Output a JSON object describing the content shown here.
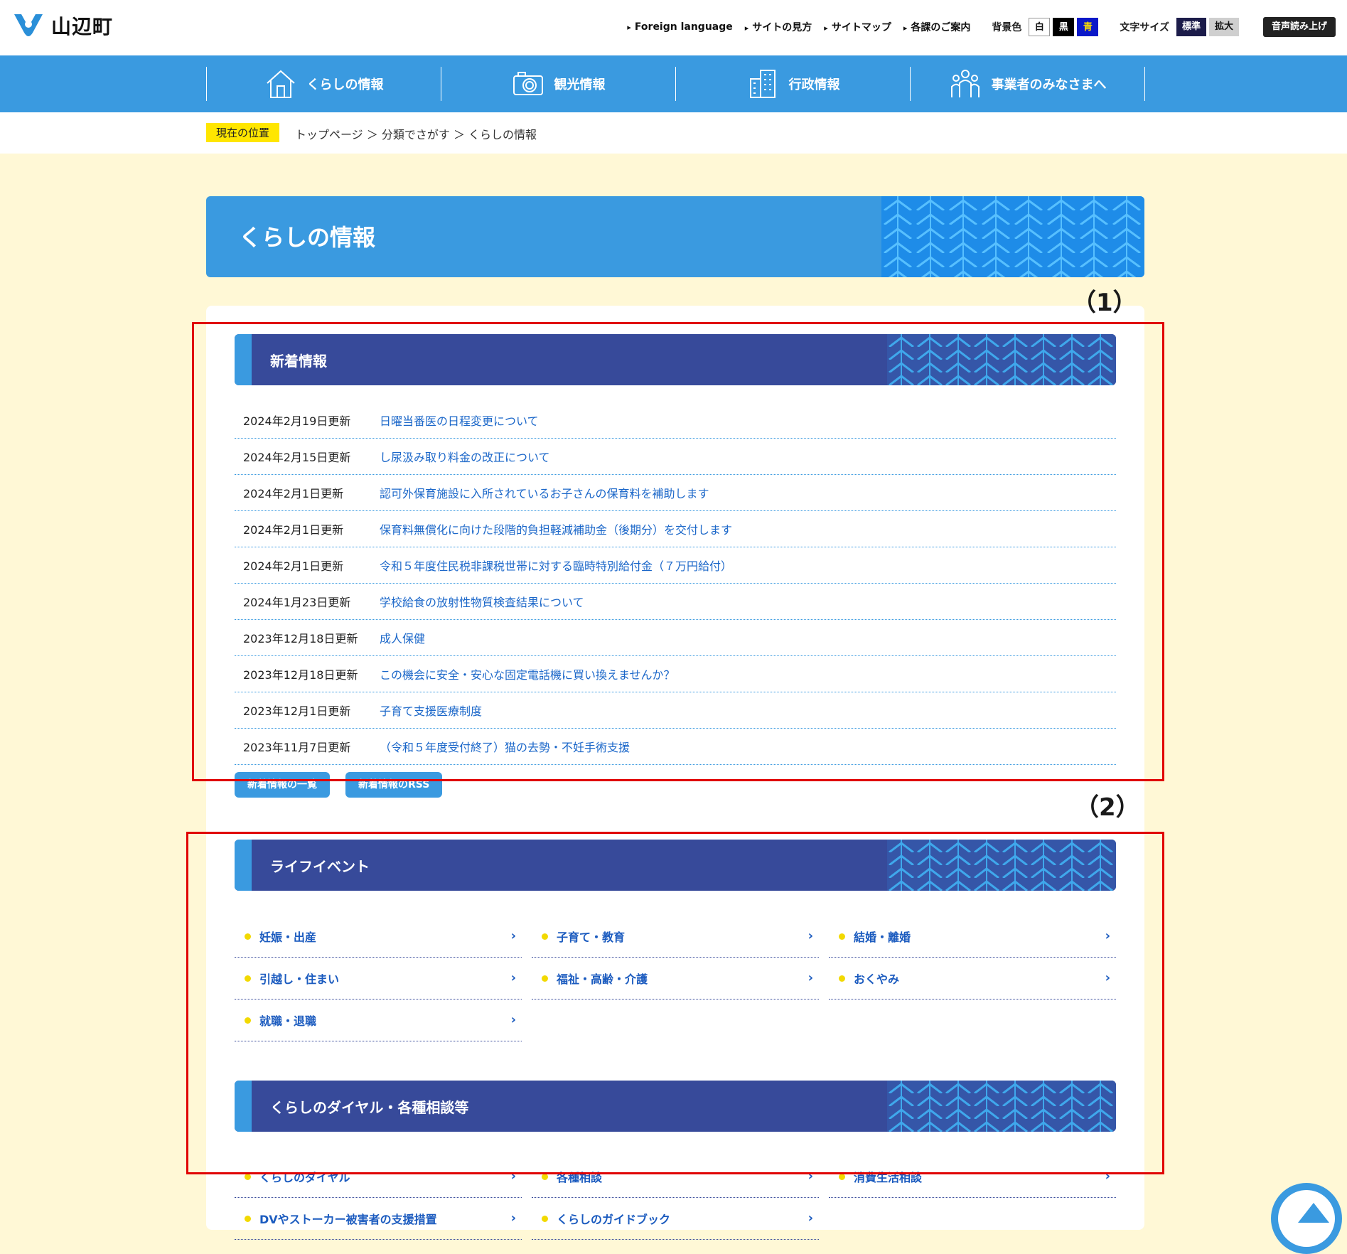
{
  "header": {
    "site_name": "山辺町",
    "links": [
      "Foreign language",
      "サイトの見方",
      "サイトマップ",
      "各課のご案内"
    ],
    "bg_label": "背景色",
    "bg_options": [
      "白",
      "黒",
      "青"
    ],
    "fontsize_label": "文字サイズ",
    "fontsize_options": [
      "標準",
      "拡大"
    ],
    "voice_label": "音声読み上げ"
  },
  "nav": [
    {
      "label": "くらしの情報",
      "icon": "house-icon"
    },
    {
      "label": "観光情報",
      "icon": "camera-icon"
    },
    {
      "label": "行政情報",
      "icon": "building-icon"
    },
    {
      "label": "事業者のみなさまへ",
      "icon": "people-icon"
    }
  ],
  "breadcrumb": {
    "label": "現在の位置",
    "path": "トップページ ＞ 分類でさがす ＞ くらしの情報"
  },
  "page_title": "くらしの情報",
  "news": {
    "title": "新着情報",
    "items": [
      {
        "date": "2024年2月19日更新",
        "title": "日曜当番医の日程変更について"
      },
      {
        "date": "2024年2月15日更新",
        "title": "し尿汲み取り料金の改正について"
      },
      {
        "date": "2024年2月1日更新",
        "title": "認可外保育施設に入所されているお子さんの保育料を補助します"
      },
      {
        "date": "2024年2月1日更新",
        "title": "保育料無償化に向けた段階的負担軽減補助金（後期分）を交付します"
      },
      {
        "date": "2024年2月1日更新",
        "title": "令和５年度住民税非課税世帯に対する臨時特別給付金（７万円給付）"
      },
      {
        "date": "2024年1月23日更新",
        "title": "学校給食の放射性物質検査結果について"
      },
      {
        "date": "2023年12月18日更新",
        "title": "成人保健"
      },
      {
        "date": "2023年12月18日更新",
        "title": "この機会に安全・安心な固定電話機に買い換えませんか？"
      },
      {
        "date": "2023年12月1日更新",
        "title": "子育て支援医療制度"
      },
      {
        "date": "2023年11月7日更新",
        "title": "（令和５年度受付終了）猫の去勢・不妊手術支援"
      }
    ],
    "buttons": [
      "新着情報の一覧",
      "新着情報のRSS"
    ]
  },
  "life_events": {
    "title": "ライフイベント",
    "items": [
      "妊娠・出産",
      "子育て・教育",
      "結婚・離婚",
      "引越し・住まい",
      "福祉・高齢・介護",
      "おくやみ",
      "就職・退職"
    ]
  },
  "dial": {
    "title": "くらしのダイヤル・各種相談等",
    "items": [
      "くらしのダイヤル",
      "各種相談",
      "消費生活相談",
      "DVやストーカー被害者の支援措置",
      "くらしのガイドブック"
    ]
  },
  "annotations": [
    "（1）",
    "（2）"
  ],
  "colors": {
    "nav_blue": "#3a9ae0",
    "section_navy": "#374a9a",
    "background_cream": "#fff8d6",
    "link_blue": "#1b67c9",
    "annotation_red": "#e00000"
  }
}
